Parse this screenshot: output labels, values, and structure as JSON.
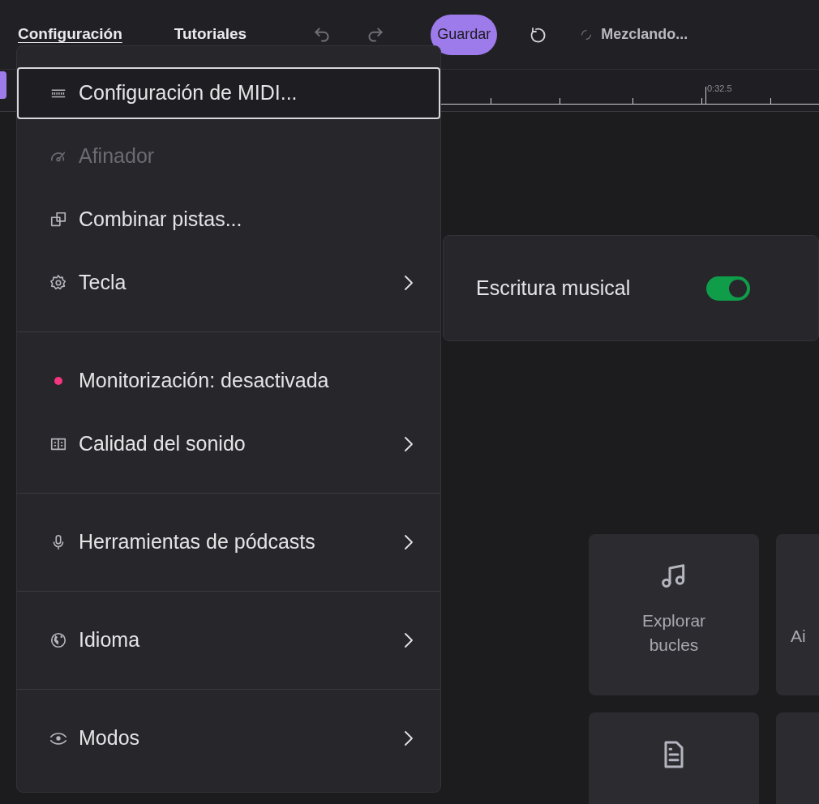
{
  "toolbar": {
    "menus": [
      {
        "label": "Configuración",
        "selected": true
      },
      {
        "label": "Tutoriales",
        "selected": false
      }
    ],
    "save_button": "Guardar",
    "status": "Mezclando..."
  },
  "timeline": {
    "marker": "0:32.5"
  },
  "menu": {
    "groups": [
      [
        {
          "kind": "icon",
          "label": "Configuración de MIDI...",
          "selected": true,
          "disabled": false,
          "submenu": false
        },
        {
          "kind": "icon",
          "label": "Afinador",
          "selected": false,
          "disabled": true,
          "submenu": false
        },
        {
          "kind": "icon",
          "label": "Combinar pistas...",
          "selected": false,
          "disabled": false,
          "submenu": false
        },
        {
          "kind": "icon",
          "label": "Tecla",
          "selected": false,
          "disabled": false,
          "submenu": true
        }
      ],
      [
        {
          "kind": "status",
          "label": "Monitorización: desactivada",
          "color": "#f4357f",
          "selected": false,
          "disabled": false,
          "submenu": false
        },
        {
          "kind": "icon",
          "label": "Calidad del sonido",
          "selected": false,
          "disabled": false,
          "submenu": true
        }
      ],
      [
        {
          "kind": "icon",
          "label": "Herramientas de pódcasts",
          "selected": false,
          "disabled": false,
          "submenu": true
        }
      ],
      [
        {
          "kind": "icon",
          "label": "Idioma",
          "selected": false,
          "disabled": false,
          "submenu": true
        }
      ],
      [
        {
          "kind": "icon",
          "label": "Modos",
          "selected": false,
          "disabled": false,
          "submenu": true
        }
      ]
    ]
  },
  "submenu": {
    "items": [
      {
        "label": "Escritura musical",
        "on": true
      }
    ]
  },
  "cards": [
    {
      "kind": "music",
      "label": "Explorar bucles"
    },
    {
      "kind": "text",
      "label": "Ai"
    },
    {
      "kind": "document"
    },
    {
      "kind": "plain"
    }
  ]
}
